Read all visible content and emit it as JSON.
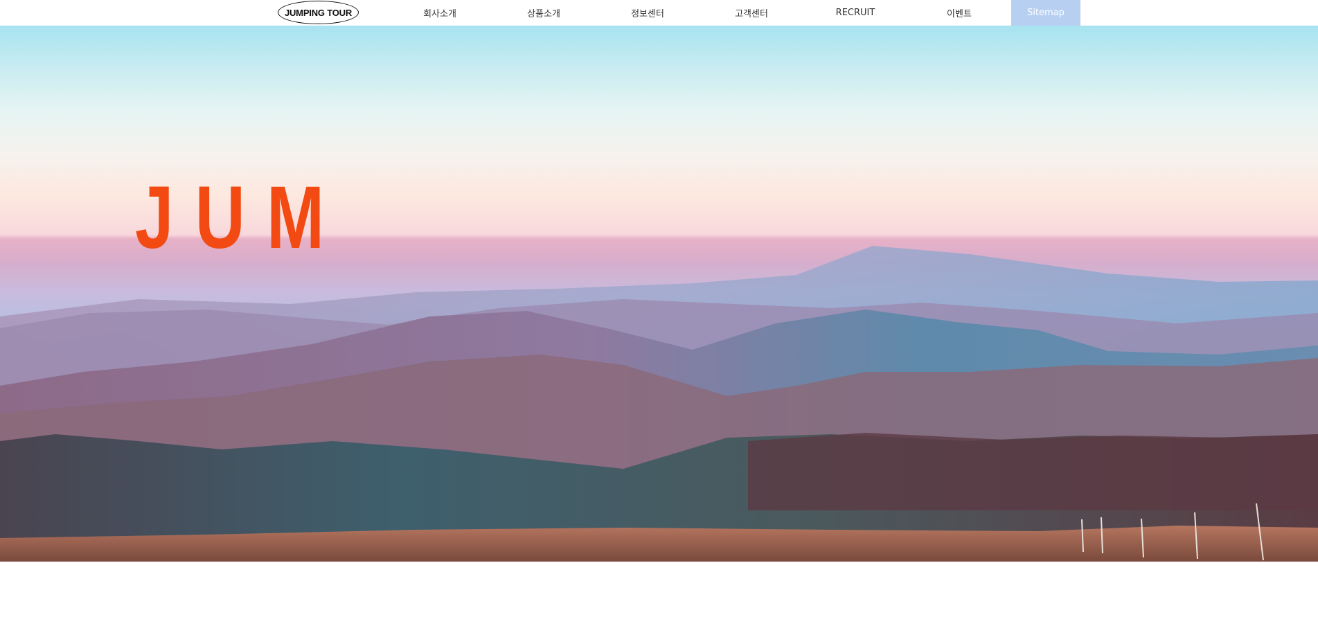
{
  "header": {
    "logo_text": "JUMPING TOUR",
    "nav": [
      {
        "label": "회사소개"
      },
      {
        "label": "상품소개"
      },
      {
        "label": "정보센터"
      },
      {
        "label": "고객센터"
      },
      {
        "label": "RECRUIT"
      },
      {
        "label": "이벤트"
      }
    ],
    "sitemap_label": "Sitemap"
  },
  "hero": {
    "headline": "JUM",
    "accent_color": "#f24a12"
  },
  "colors": {
    "sitemap_bg": "#b7d0f2",
    "header_bg": "#ffffff"
  }
}
